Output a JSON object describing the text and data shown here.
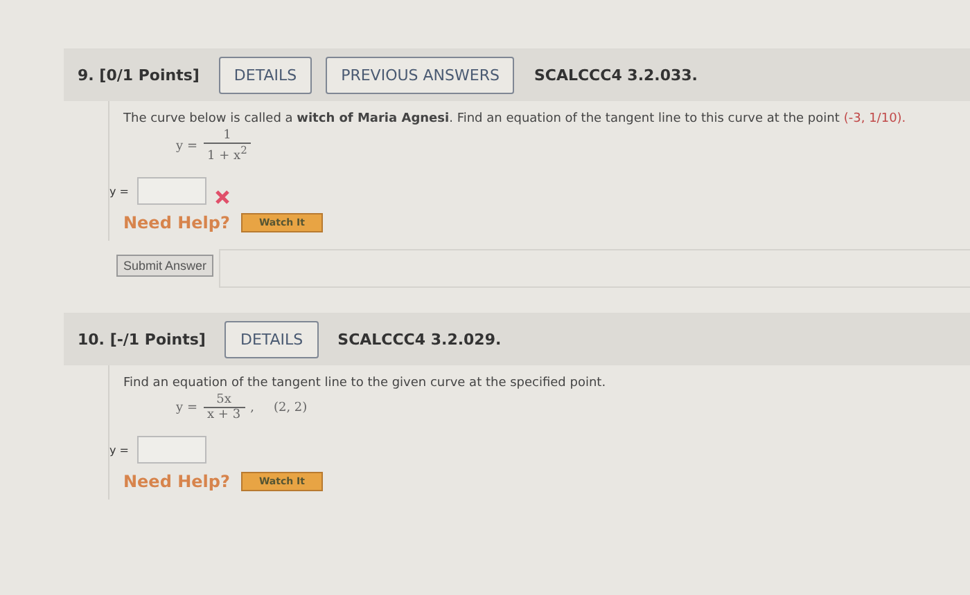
{
  "problems": [
    {
      "number": "9.",
      "points": "[0/1 Points]",
      "buttons": [
        "DETAILS",
        "PREVIOUS ANSWERS"
      ],
      "code": "SCALCCC4 3.2.033.",
      "prompt": "The curve below is called a **witch of Maria Agnesi**. Find an equation of the tangent line to this curve at the point",
      "prompt_point": "(-3, 1/10).",
      "equation": {
        "lhs": "y =",
        "numerator": "1",
        "denominator": "1 + x$^{2}$"
      },
      "answer": {
        "label": "y =",
        "incorrect": true
      },
      "help": {
        "label": "Need Help?",
        "button": "Watch It"
      },
      "submit": "Submit Answer"
    },
    {
      "number": "10.",
      "points": "[-/1 Points]",
      "buttons": [
        "DETAILS"
      ],
      "code": "SCALCCC4 3.2.029.",
      "prompt": "Find an equation of the tangent line to the given curve at the specified point.",
      "equation": {
        "lhs": "y =",
        "numerator": "5x",
        "denominator": "x + 3",
        "trailing": ",",
        "point": "(2, 2)"
      },
      "answer": {
        "label": "y =",
        "incorrect": false
      },
      "help": {
        "label": "Need Help?",
        "button": "Watch It"
      }
    }
  ]
}
